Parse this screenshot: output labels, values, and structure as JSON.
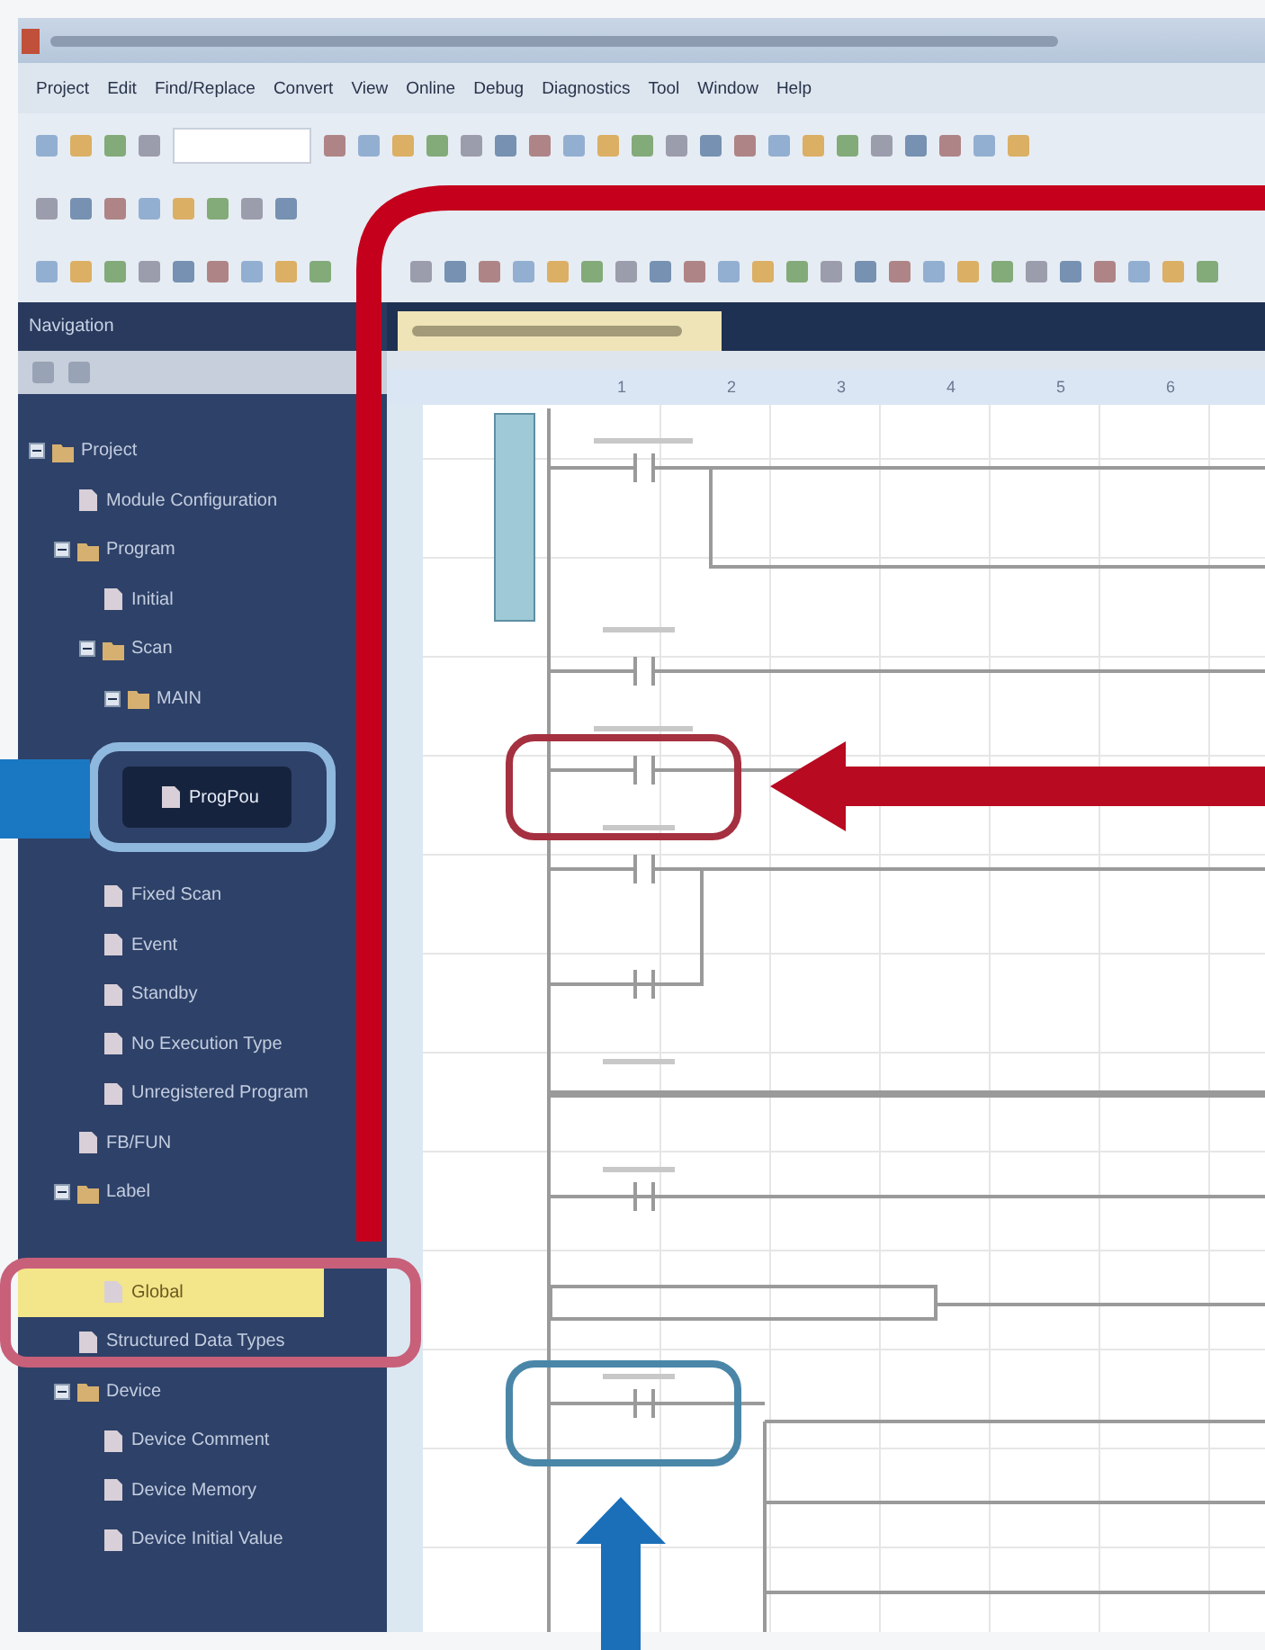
{
  "menu": [
    {
      "label": "Project"
    },
    {
      "label": "Edit"
    },
    {
      "label": "Find/Replace"
    },
    {
      "label": "Convert"
    },
    {
      "label": "View"
    },
    {
      "label": "Online"
    },
    {
      "label": "Debug"
    },
    {
      "label": "Diagnostics"
    },
    {
      "label": "Tool"
    },
    {
      "label": "Window"
    },
    {
      "label": "Help"
    }
  ],
  "navigation": {
    "title": "Navigation",
    "tree": [
      {
        "label": "Project",
        "expanded": true,
        "selected": false,
        "highlighted": false,
        "children": [
          {
            "label": "Module Configuration",
            "selected": false,
            "highlighted": false
          },
          {
            "label": "Program",
            "expanded": true,
            "selected": false,
            "highlighted": false,
            "children": [
              {
                "label": "Initial",
                "selected": false,
                "highlighted": false
              },
              {
                "label": "Scan",
                "expanded": true,
                "selected": false,
                "highlighted": false,
                "children": [
                  {
                    "label": "MAIN",
                    "expanded": true,
                    "selected": false,
                    "highlighted": false,
                    "children": [
                      {
                        "label": "ProgPou",
                        "selected": true,
                        "highlighted": false
                      }
                    ]
                  }
                ]
              },
              {
                "label": "Fixed Scan",
                "selected": false,
                "highlighted": false
              },
              {
                "label": "Event",
                "selected": false,
                "highlighted": false
              },
              {
                "label": "Standby",
                "selected": false,
                "highlighted": false
              },
              {
                "label": "No Execution Type",
                "selected": false,
                "highlighted": false
              },
              {
                "label": "Unregistered Program",
                "selected": false,
                "highlighted": false
              }
            ]
          },
          {
            "label": "FB/FUN",
            "selected": false,
            "highlighted": false
          },
          {
            "label": "Label",
            "expanded": true,
            "selected": false,
            "highlighted": false,
            "children": [
              {
                "label": "Global",
                "selected": false,
                "highlighted": true
              }
            ]
          },
          {
            "label": "Structured Data Types",
            "selected": false,
            "highlighted": false
          },
          {
            "label": "Device",
            "expanded": true,
            "selected": false,
            "highlighted": false,
            "children": [
              {
                "label": "Device Comment",
                "selected": false,
                "highlighted": false
              },
              {
                "label": "Device Memory",
                "selected": false,
                "highlighted": false
              },
              {
                "label": "Device Initial Value",
                "selected": false,
                "highlighted": false
              }
            ]
          }
        ]
      }
    ]
  },
  "editor": {
    "ruler": [
      "1",
      "2",
      "3",
      "4",
      "5",
      "6"
    ]
  }
}
